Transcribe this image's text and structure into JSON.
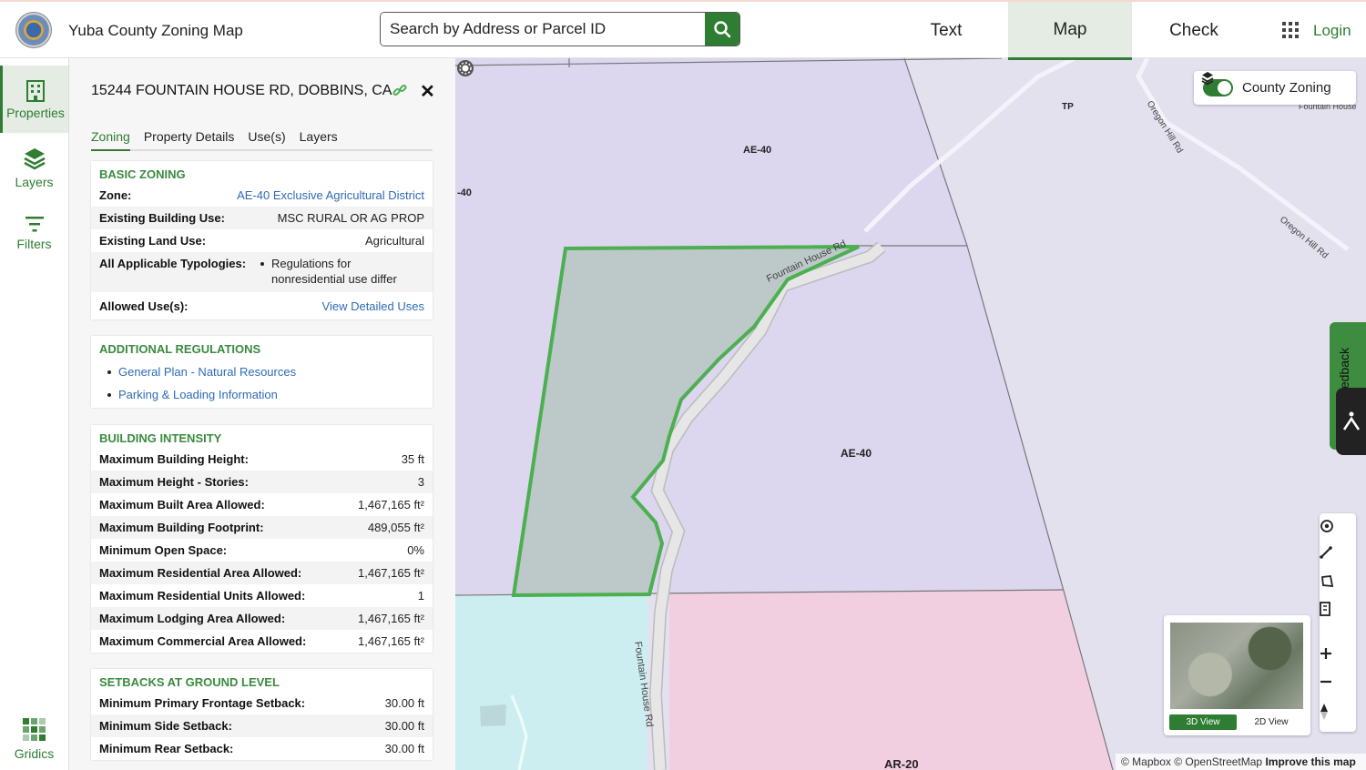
{
  "app": {
    "title": "Yuba County Zoning Map"
  },
  "search": {
    "placeholder": "Search by Address or Parcel ID"
  },
  "nav": {
    "tabs": [
      "Text",
      "Map",
      "Check"
    ],
    "active": "Map",
    "login": "Login"
  },
  "sidebar": {
    "items": [
      {
        "label": "Properties",
        "icon": "building-icon",
        "active": true
      },
      {
        "label": "Layers",
        "icon": "layers-icon"
      },
      {
        "label": "Filters",
        "icon": "filter-icon"
      },
      {
        "label": "Gridics",
        "icon": "gridics-logo-icon"
      }
    ]
  },
  "panel": {
    "address": "15244 FOUNTAIN HOUSE RD, DOBBINS, CA",
    "tabs": [
      "Zoning",
      "Property Details",
      "Use(s)",
      "Layers"
    ],
    "active_tab": "Zoning",
    "basic_zoning": {
      "title": "BASIC ZONING",
      "zone_label": "Zone:",
      "zone_value": "AE-40 Exclusive Agricultural District",
      "building_use_label": "Existing Building Use:",
      "building_use_value": "MSC RURAL OR AG PROP",
      "land_use_label": "Existing Land Use:",
      "land_use_value": "Agricultural",
      "typologies_label": "All Applicable Typologies:",
      "typologies_value": "Regulations for nonresidential use differ",
      "allowed_uses_label": "Allowed Use(s):",
      "allowed_uses_value": "View Detailed Uses"
    },
    "additional_regulations": {
      "title": "ADDITIONAL REGULATIONS",
      "links": [
        "General Plan - Natural Resources",
        "Parking & Loading Information"
      ]
    },
    "building_intensity": {
      "title": "BUILDING INTENSITY",
      "rows": [
        {
          "label": "Maximum Building Height:",
          "value": "35 ft"
        },
        {
          "label": "Maximum Height - Stories:",
          "value": "3"
        },
        {
          "label": "Maximum Built Area Allowed:",
          "value": "1,467,165 ft²"
        },
        {
          "label": "Maximum Building Footprint:",
          "value": "489,055 ft²"
        },
        {
          "label": "Minimum Open Space:",
          "value": "0%"
        },
        {
          "label": "Maximum Residential Area Allowed:",
          "value": "1,467,165 ft²"
        },
        {
          "label": "Maximum Residential Units Allowed:",
          "value": "1"
        },
        {
          "label": "Maximum Lodging Area Allowed:",
          "value": "1,467,165 ft²"
        },
        {
          "label": "Maximum Commercial Area Allowed:",
          "value": "1,467,165 ft²"
        }
      ]
    },
    "setbacks": {
      "title": "SETBACKS AT GROUND LEVEL",
      "rows": [
        {
          "label": "Minimum Primary Frontage Setback:",
          "value": "30.00 ft"
        },
        {
          "label": "Minimum Side Setback:",
          "value": "30.00 ft"
        },
        {
          "label": "Minimum Rear Setback:",
          "value": "30.00 ft"
        }
      ]
    }
  },
  "map": {
    "zone_labels": [
      "AE-40",
      "-40",
      "AE-40",
      "AR-20",
      "TP"
    ],
    "road_labels": [
      "Fountain House Rd",
      "Fountain House Rd",
      "Oregon Hill Rd",
      "Oregon Hill Rd",
      "Fountain House"
    ],
    "layer_toggle": {
      "label": "County Zoning",
      "on": true
    },
    "feedback": "Feedback",
    "visible_feedback_text": "edback",
    "minimap": {
      "view_3d": "3D View",
      "view_2d": "2D View",
      "active": "3D View"
    },
    "attribution": {
      "mapbox": "© Mapbox",
      "osm": "© OpenStreetMap",
      "improve": "Improve this map"
    },
    "colors": {
      "ae40": "#dcd7ee",
      "ag_open": "#e4e1ef",
      "ar20": "#f2cfe0",
      "water_zone": "#cdeef0",
      "selected_fill": "#b9c6c4",
      "selected_outline": "#4caf50"
    }
  },
  "accent_color": "#2e7d32"
}
